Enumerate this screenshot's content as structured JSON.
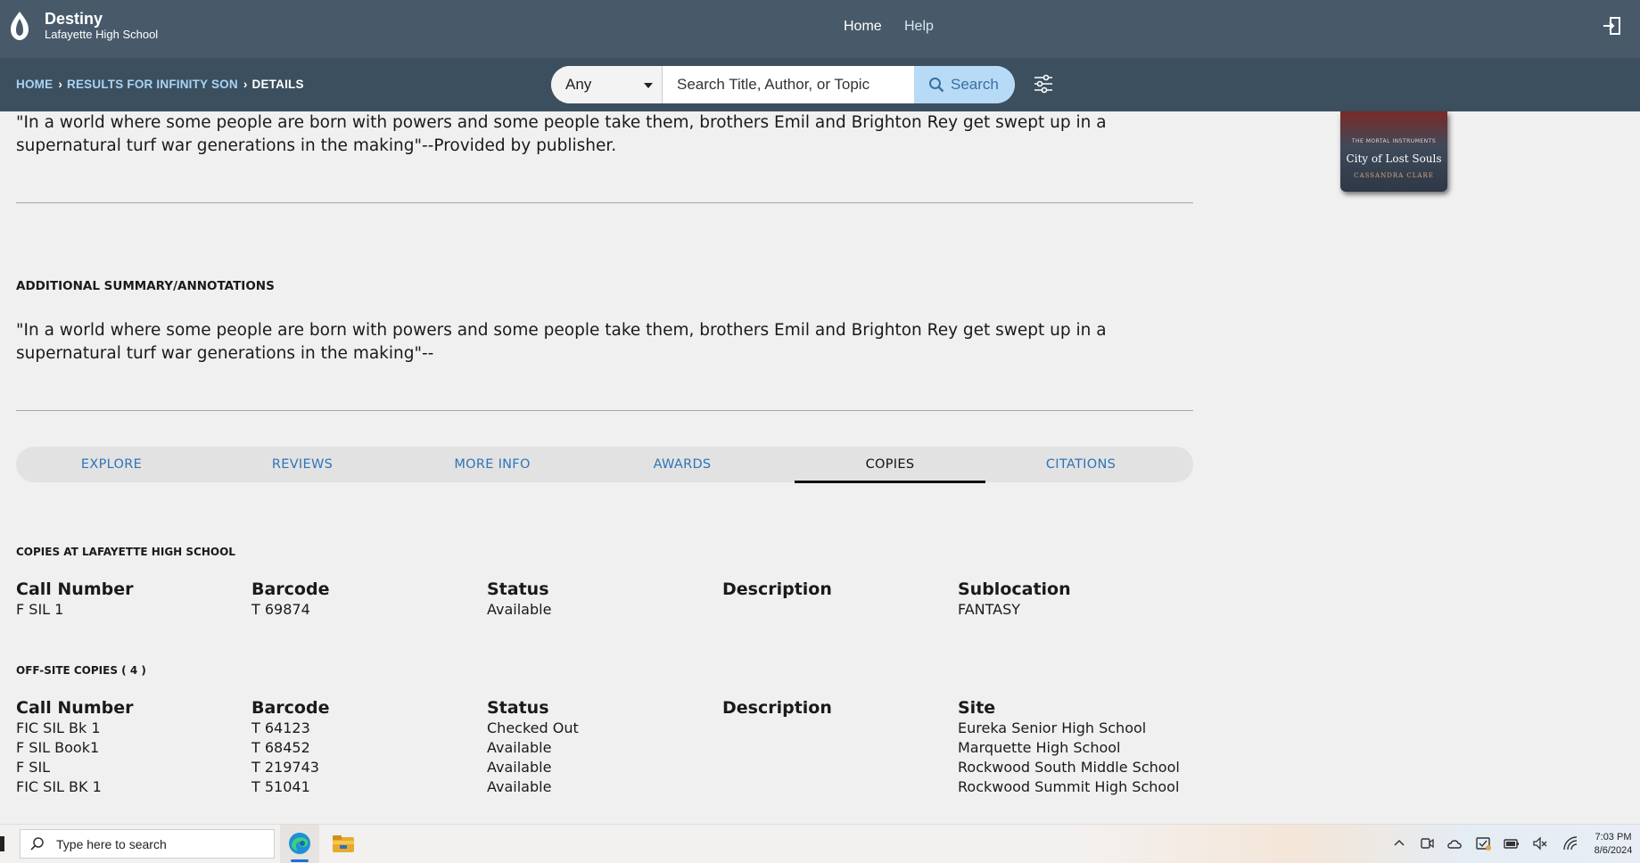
{
  "header": {
    "brand_title": "Destiny",
    "brand_subtitle": "Lafayette High School",
    "nav": {
      "home": "Home",
      "help": "Help"
    }
  },
  "breadcrumb": {
    "items": [
      "HOME",
      "RESULTS FOR INFINITY SON",
      "DETAILS"
    ]
  },
  "search": {
    "scope_value": "Any",
    "placeholder": "Search Title, Author, or Topic",
    "value": "",
    "button_label": "Search"
  },
  "summary": {
    "text": "\"In a world where some people are born with powers and some people take them, brothers Emil and Brighton Rey get swept up in a supernatural turf war generations in the making\"--Provided by publisher."
  },
  "additional": {
    "heading": "ADDITIONAL SUMMARY/ANNOTATIONS",
    "text": "\"In a world where some people are born with powers and some people take them, brothers Emil and Brighton Rey get swept up in a supernatural turf war generations in the making\"--"
  },
  "book_cover": {
    "series": "THE MORTAL INSTRUMENTS",
    "title": "City of Lost Souls",
    "author": "CASSANDRA CLARE"
  },
  "tabs": [
    {
      "label": "EXPLORE",
      "active": false
    },
    {
      "label": "REVIEWS",
      "active": false
    },
    {
      "label": "MORE INFO",
      "active": false
    },
    {
      "label": "AWARDS",
      "active": false
    },
    {
      "label": "COPIES",
      "active": true
    },
    {
      "label": "CITATIONS",
      "active": false
    }
  ],
  "local_copies": {
    "heading": "COPIES AT LAFAYETTE HIGH SCHOOL",
    "columns": [
      "Call Number",
      "Barcode",
      "Status",
      "Description",
      "Sublocation"
    ],
    "rows": [
      [
        "F SIL 1",
        "T 69874",
        "Available",
        "",
        "FANTASY"
      ]
    ]
  },
  "offsite_copies": {
    "heading": "OFF-SITE COPIES ( 4 )",
    "columns": [
      "Call Number",
      "Barcode",
      "Status",
      "Description",
      "Site"
    ],
    "rows": [
      [
        "FIC SIL Bk 1",
        "T 64123",
        "Checked Out",
        "",
        "Eureka Senior High School"
      ],
      [
        "F SIL Book1",
        "T 68452",
        "Available",
        "",
        "Marquette High School"
      ],
      [
        "F SIL",
        "T 219743",
        "Available",
        "",
        "Rockwood South Middle School"
      ],
      [
        "FIC SIL BK 1",
        "T 51041",
        "Available",
        "",
        "Rockwood Summit High School"
      ]
    ]
  },
  "taskbar": {
    "search_placeholder": "Type here to search",
    "time": "7:03 PM",
    "date": "8/6/2024"
  },
  "colors": {
    "header_bg": "#485a6a",
    "subbar_bg": "#3c4f5f",
    "link_blue": "#2f74b8",
    "search_button_bg": "#b7daf7"
  }
}
